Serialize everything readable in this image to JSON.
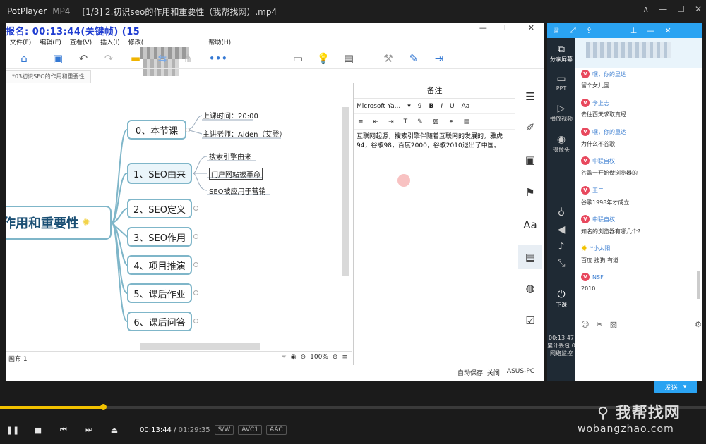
{
  "player": {
    "brand": "PotPlayer",
    "format": "MP4",
    "title": "[1/3] 2.初识seo的作用和重要性（我帮找网）.mp4",
    "time_current": "00:13:44",
    "time_total": "01:29:35",
    "badges": [
      "S/W",
      "AVC1",
      "AAC"
    ],
    "progress_fraction": 0.146,
    "watermark": "我帮找网",
    "watermark_url": "wobangzhao.com"
  },
  "app": {
    "overlay_text": "报名: 00:13:44(关键帧) (15",
    "menu": [
      "文件(F)",
      "编辑(E)",
      "查看(V)",
      "插入(I)",
      "修改(",
      "帮助(H)"
    ],
    "doc_tab": "*03初识SEO的作用和重要性",
    "status_left": "画布 1",
    "zoom": "100%",
    "autosave": "自动保存: 关闭",
    "machine": "ASUS-PC"
  },
  "mindmap": {
    "root": "作用和重要性",
    "nodes": [
      {
        "label": "0、本节课"
      },
      {
        "label": "1、SEO由来"
      },
      {
        "label": "2、SEO定义"
      },
      {
        "label": "3、SEO作用"
      },
      {
        "label": "4、项目推演"
      },
      {
        "label": "5、课后作业"
      },
      {
        "label": "6、课后问答"
      }
    ],
    "leaves_0": [
      "上课时间：20:00",
      "主讲老师：Aiden（艾登）"
    ],
    "leaves_1": [
      "搜索引擎由来",
      "门户网站被革命",
      "SEO被应用于营销"
    ]
  },
  "notes": {
    "title": "备注",
    "font": "Microsoft Ya...",
    "size": "9",
    "body": "互联网起源，搜索引擎伴随着互联网的发展的。雅虎94，谷歌98，百度2000，谷歌2010退出了中国。"
  },
  "chat": {
    "side": [
      {
        "label": "分享屏幕"
      },
      {
        "label": "PPT"
      },
      {
        "label": "播放视频"
      },
      {
        "label": "摄像头"
      },
      {
        "label": "下课"
      }
    ],
    "live_time": "00:13:47",
    "live_info": "累计丢包 0 网络监控",
    "messages": [
      {
        "user": "嘿，你的显达",
        "text": "留个女儿国"
      },
      {
        "user": "李上志",
        "text": "去往西天求取真经"
      },
      {
        "user": "嘿，你的显达",
        "text": "为什么不谷歌"
      },
      {
        "user": "中联自权",
        "text": "谷歌一开始做浏览器的"
      },
      {
        "user": "王二",
        "text": "谷歌1998年才成立"
      },
      {
        "user": "中联自权",
        "text": "知名的浏览器有哪几个?"
      },
      {
        "user": "*小太阳",
        "text": "百度 搜狗 有道"
      },
      {
        "user": "NSF",
        "text": "2010"
      }
    ],
    "send": "发送"
  }
}
